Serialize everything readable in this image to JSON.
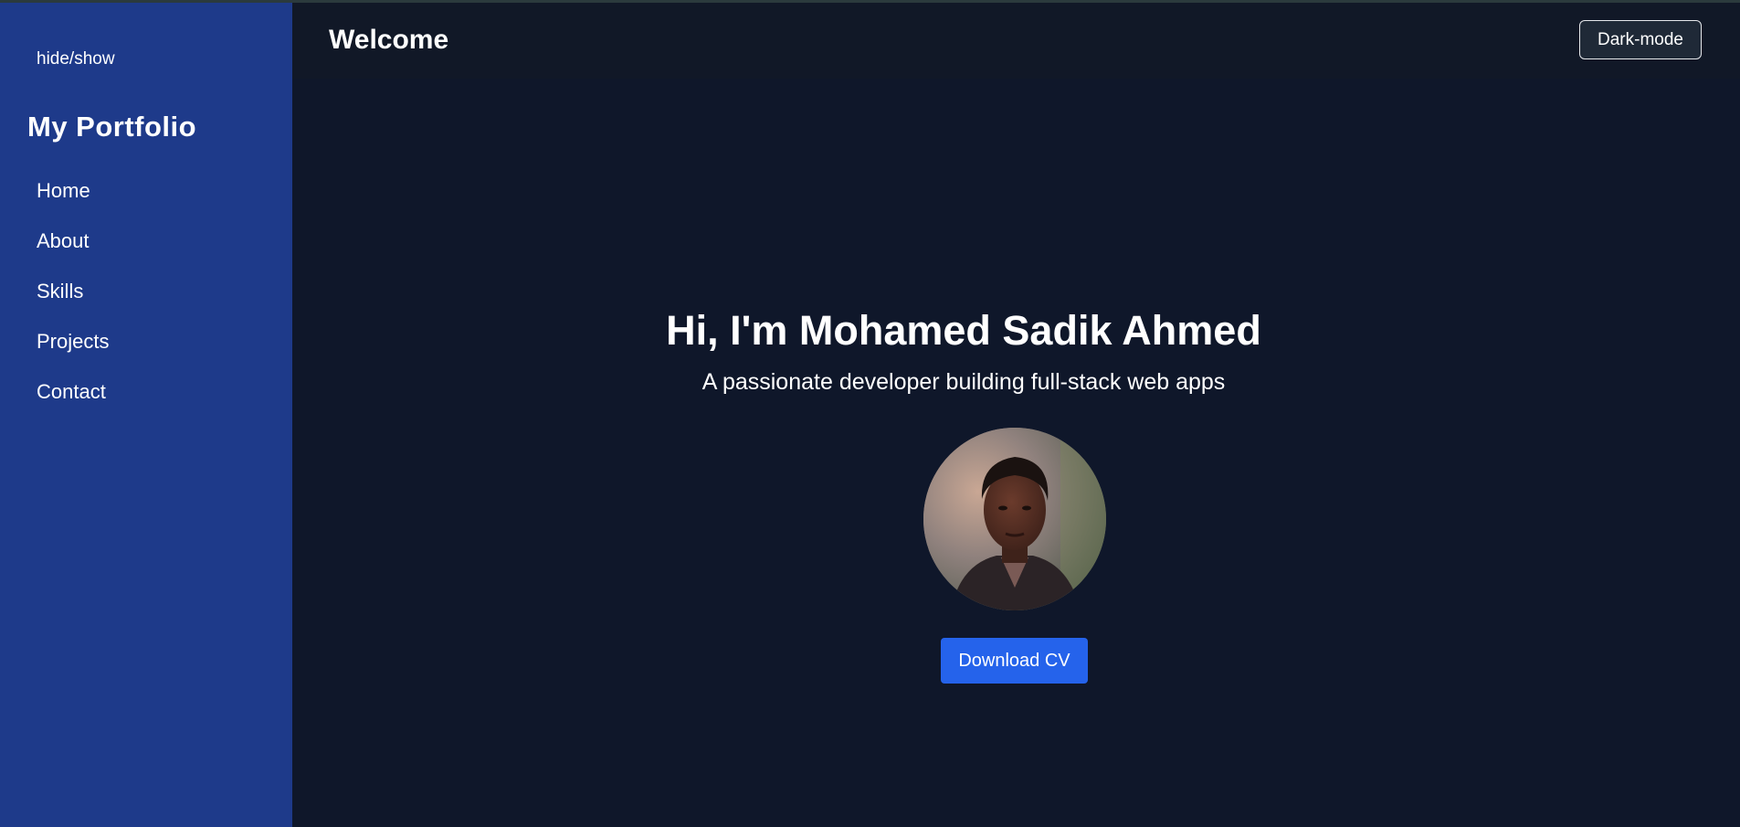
{
  "sidebar": {
    "toggle_label": "hide/show",
    "brand": "My Portfolio",
    "nav": [
      {
        "label": "Home"
      },
      {
        "label": "About"
      },
      {
        "label": "Skills"
      },
      {
        "label": "Projects"
      },
      {
        "label": "Contact"
      }
    ]
  },
  "header": {
    "title": "Welcome",
    "mode_button": "Dark-mode"
  },
  "hero": {
    "title": "Hi, I'm Mohamed Sadik Ahmed",
    "subtitle": "A passionate developer building full-stack web apps",
    "cv_button": "Download CV"
  },
  "colors": {
    "sidebar_bg": "#1e3a8a",
    "main_bg": "#0f172a",
    "header_bg": "#111827",
    "accent": "#2563eb"
  }
}
